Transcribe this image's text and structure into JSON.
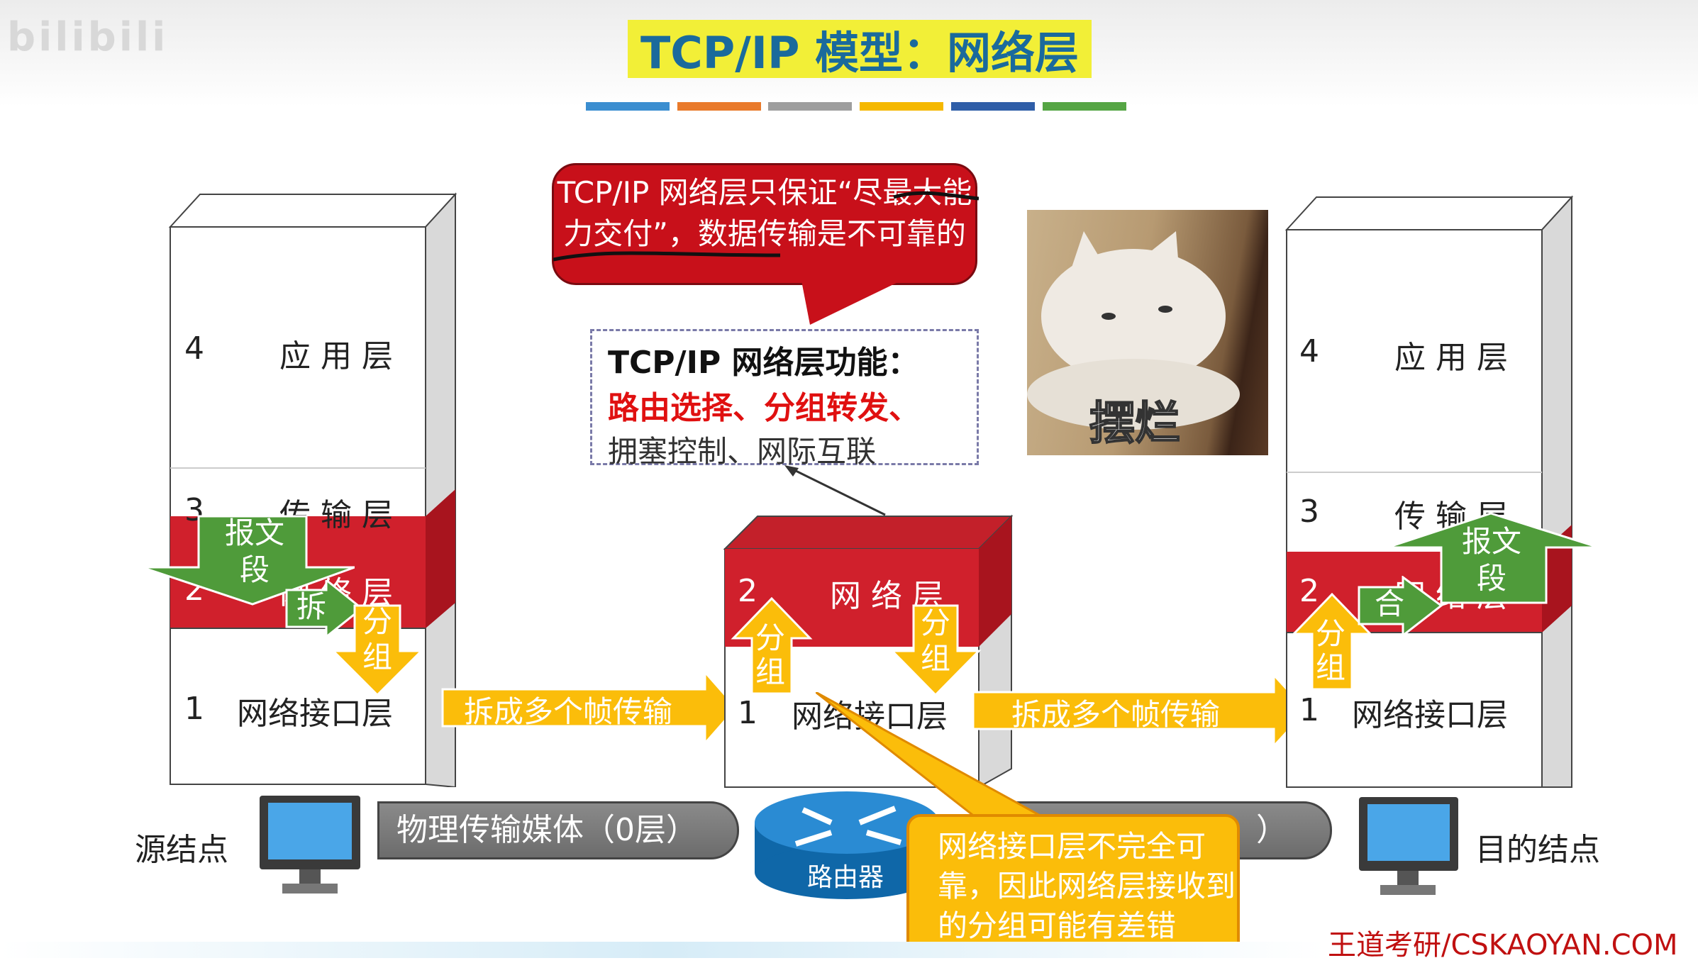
{
  "watermark": "bilibili",
  "title": "TCP/IP 模型：网络层",
  "title_bar_colors": [
    "#3b8ed0",
    "#e97a2b",
    "#9e9e9e",
    "#f5b800",
    "#2f5ea8",
    "#55a544"
  ],
  "layers": {
    "app": {
      "num": "4",
      "name": "应 用 层"
    },
    "transport": {
      "num": "3",
      "name": "传 输 层"
    },
    "network": {
      "num": "2",
      "name": "网 络 层"
    },
    "link": {
      "num": "1",
      "name": "网络接口层"
    }
  },
  "arrows": {
    "segment": "报文段",
    "split": "拆",
    "merge": "合",
    "packet": "分组",
    "frames": "拆成多个帧传输"
  },
  "callout_red": "TCP/IP 网络层只保证“尽最大能力交付”，数据传输是不可靠的",
  "function_box": {
    "title": "TCP/IP 网络层功能：",
    "highlight": "路由选择、分组转发、",
    "rest": "拥塞控制、网际互联"
  },
  "meme_text": "摆烂",
  "medium_label": "物理传输媒体（0层）",
  "medium_label_right": "）",
  "router_label": "路由器",
  "source_label": "源结点",
  "dest_label": "目的结点",
  "yellow_note": "网络接口层不完全可靠，因此网络层接收到的分组可能有差错",
  "footer": "王道考研/CSKAOYAN.COM"
}
